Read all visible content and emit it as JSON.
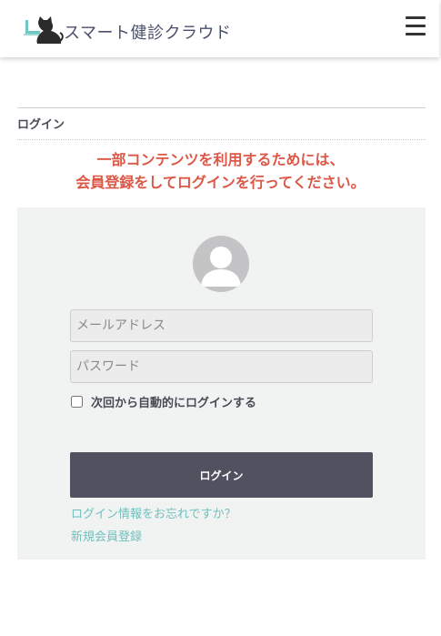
{
  "header": {
    "logo_text": "スマート健診クラウド",
    "logo_icon": "cat-at-laptop-icon",
    "menu_icon": "hamburger-menu-icon"
  },
  "breadcrumb": {
    "label": "ログイン"
  },
  "notice": {
    "line1": "一部コンテンツを利用するためには、",
    "line2": "会員登録をしてログインを行ってください。"
  },
  "login_form": {
    "avatar_icon": "user-avatar-icon",
    "email_placeholder": "メールアドレス",
    "email_value": "",
    "password_placeholder": "パスワード",
    "password_value": "",
    "remember_label": "次回から自動的にログインする",
    "remember_checked": false,
    "submit_label": "ログイン",
    "forgot_link": "ログイン情報をお忘れですか？",
    "register_link": "新規会員登録"
  },
  "colors": {
    "notice": "#dc5746",
    "button": "#51515f",
    "link": "#6fc0bd",
    "panel": "#f1f3f3"
  }
}
